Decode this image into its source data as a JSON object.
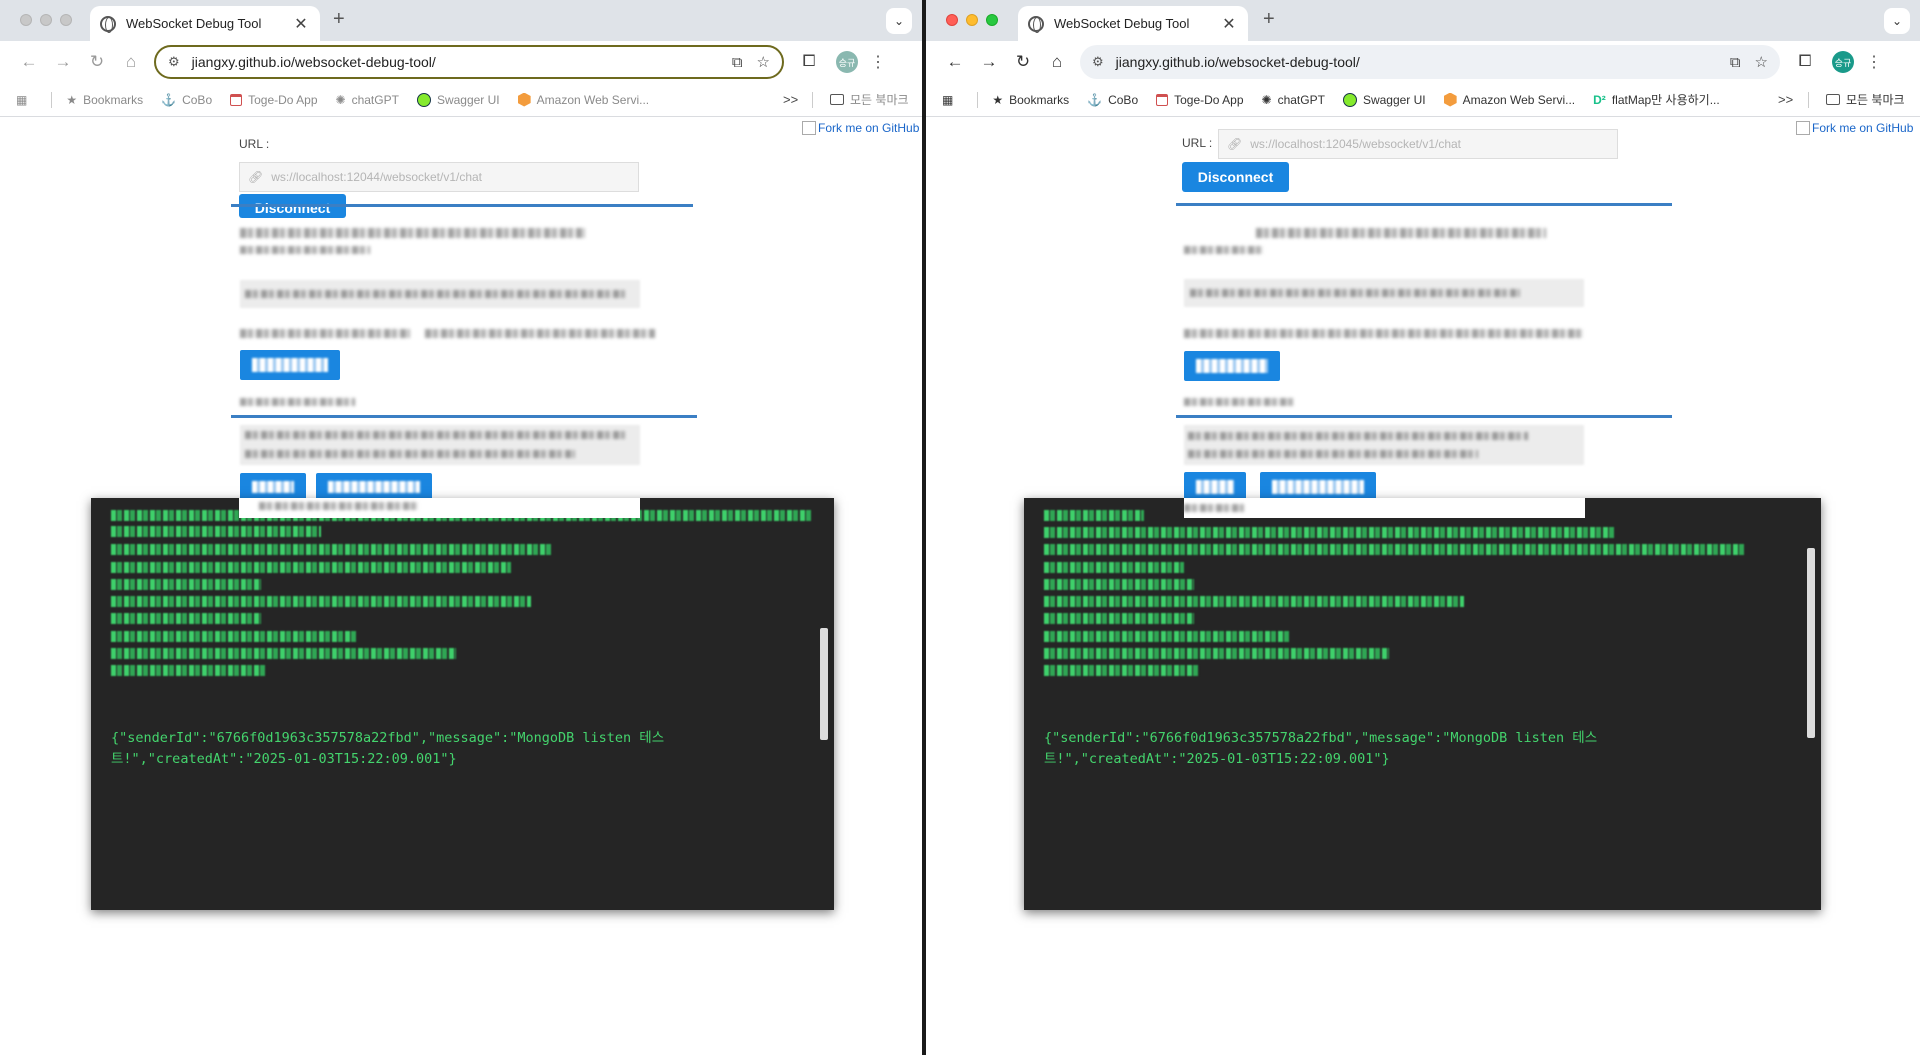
{
  "windows": {
    "left": {
      "tab_title": "WebSocket Debug Tool",
      "address": "jiangxy.github.io/websocket-debug-tool/",
      "url_label": "URL :",
      "url_placeholder": "ws://localhost:12044/websocket/v1/chat",
      "connect_button": "Disconnect",
      "fork_link": "Fork me on GitHub",
      "console_message": "{\"senderId\":\"6766f0d1963c357578a22fbd\",\"message\":\"MongoDB listen 테스트!\",\"createdAt\":\"2025-01-03T15:22:09.001\"}"
    },
    "right": {
      "tab_title": "WebSocket Debug Tool",
      "address": "jiangxy.github.io/websocket-debug-tool/",
      "url_label": "URL :",
      "url_placeholder": "ws://localhost:12045/websocket/v1/chat",
      "connect_button": "Disconnect",
      "fork_link": "Fork me on GitHub",
      "console_message": "{\"senderId\":\"6766f0d1963c357578a22fbd\",\"message\":\"MongoDB listen 테스트!\",\"createdAt\":\"2025-01-03T15:22:09.001\"}"
    }
  },
  "bookmarks": {
    "bookmarks": "Bookmarks",
    "cobo": "CoBo",
    "togedo": "Toge-Do App",
    "chatgpt": "chatGPT",
    "swagger": "Swagger UI",
    "aws": "Amazon Web Servi...",
    "flatmap": "flatMap만 사용하기...",
    "all_bookmarks": "모든 북마크",
    "more": ">>"
  },
  "profile_initials": "승규",
  "colors": {
    "button_blue": "#1a86e0",
    "console_bg": "#252525",
    "console_text": "#44d46d",
    "divider_blue": "#3b7fc4"
  }
}
